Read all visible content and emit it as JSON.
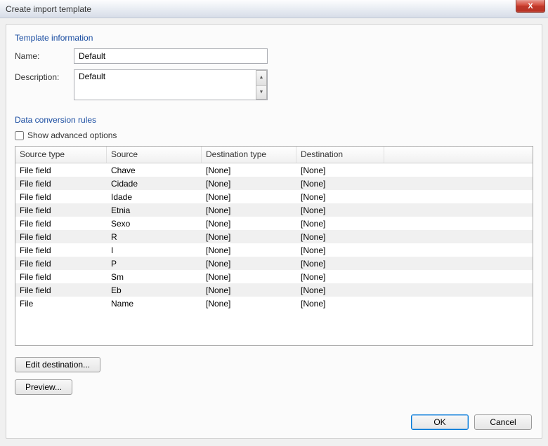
{
  "window": {
    "title": "Create import template",
    "close_x": "X"
  },
  "template_info": {
    "heading": "Template information",
    "name_label": "Name:",
    "name_value": "Default",
    "desc_label": "Description:",
    "desc_value": "Default"
  },
  "conversion": {
    "heading": "Data conversion rules",
    "show_advanced_label": "Show advanced options",
    "show_advanced_checked": false,
    "headers": {
      "source_type": "Source type",
      "source": "Source",
      "dest_type": "Destination type",
      "dest": "Destination"
    },
    "rows": [
      {
        "st": "File field",
        "src": "Chave",
        "dt": "[None]",
        "d": "[None]"
      },
      {
        "st": "File field",
        "src": "Cidade",
        "dt": "[None]",
        "d": "[None]"
      },
      {
        "st": "File field",
        "src": "Idade",
        "dt": "[None]",
        "d": "[None]"
      },
      {
        "st": "File field",
        "src": "Etnia",
        "dt": "[None]",
        "d": "[None]"
      },
      {
        "st": "File field",
        "src": "Sexo",
        "dt": "[None]",
        "d": "[None]"
      },
      {
        "st": "File field",
        "src": "R",
        "dt": "[None]",
        "d": "[None]"
      },
      {
        "st": "File field",
        "src": "I",
        "dt": "[None]",
        "d": "[None]"
      },
      {
        "st": "File field",
        "src": "P",
        "dt": "[None]",
        "d": "[None]"
      },
      {
        "st": "File field",
        "src": "Sm",
        "dt": "[None]",
        "d": "[None]"
      },
      {
        "st": "File field",
        "src": "Eb",
        "dt": "[None]",
        "d": "[None]"
      },
      {
        "st": "File",
        "src": "Name",
        "dt": "[None]",
        "d": "[None]"
      }
    ]
  },
  "buttons": {
    "edit_destination": "Edit destination...",
    "preview": "Preview...",
    "ok": "OK",
    "cancel": "Cancel"
  }
}
